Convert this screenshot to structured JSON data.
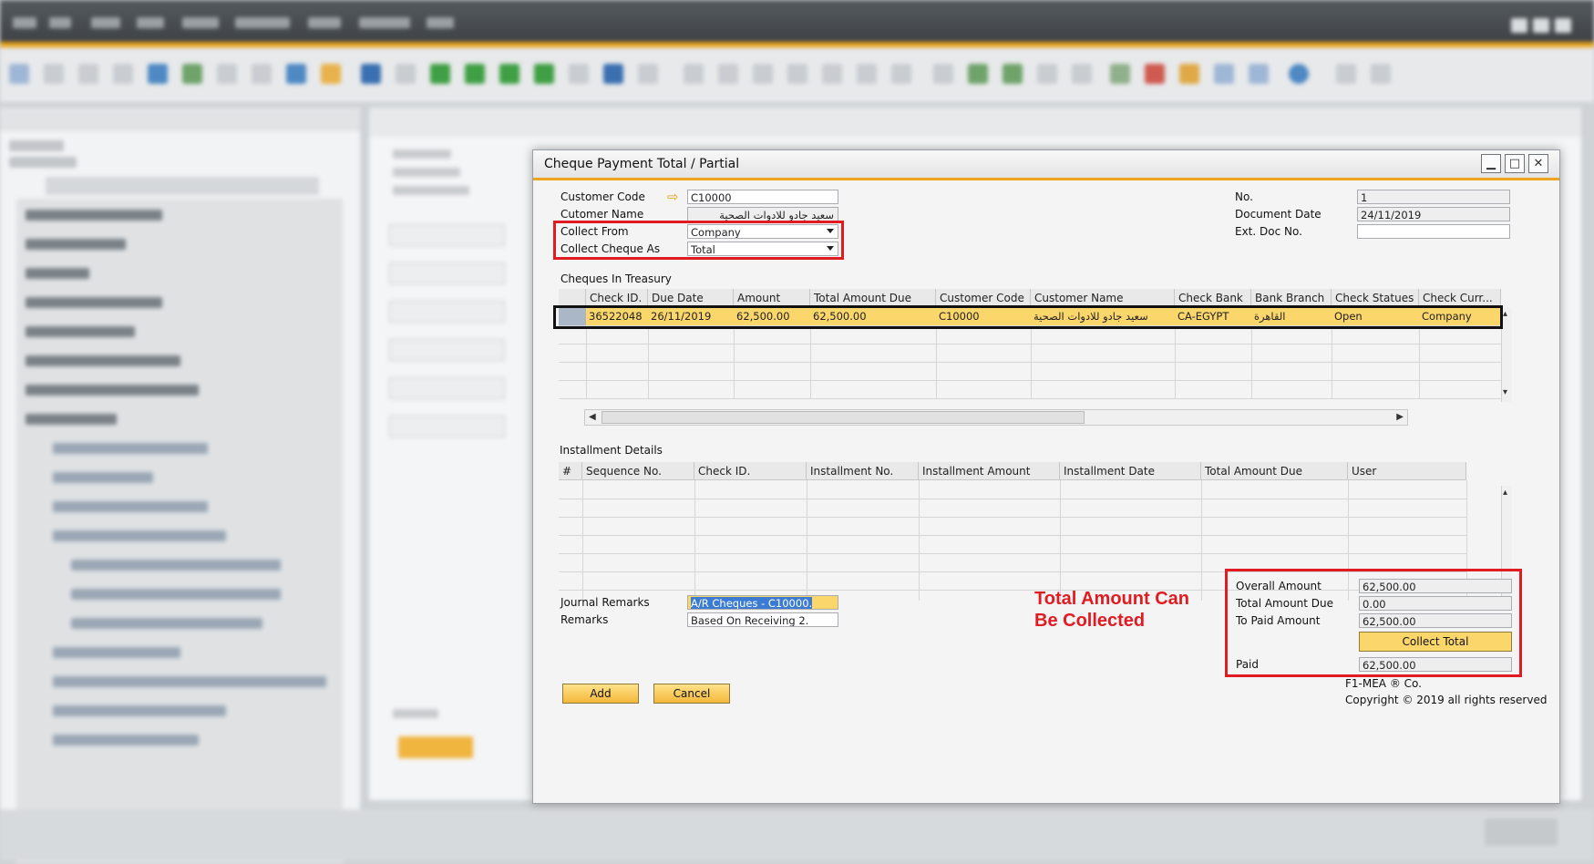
{
  "dialog": {
    "title": "Cheque Payment Total / Partial",
    "buttons": {
      "minimize": "▁",
      "maximize": "□",
      "close": "✕"
    }
  },
  "header": {
    "customer_code_label": "Customer Code",
    "customer_code": "C10000",
    "customer_name_label": "Cutomer Name",
    "customer_name": "سعيد جادو للادوات الصحية",
    "collect_from_label": "Collect From",
    "collect_from": "Company",
    "collect_as_label": "Collect Cheque As",
    "collect_as": "Total",
    "no_label": "No.",
    "no": "1",
    "doc_date_label": "Document Date",
    "doc_date": "24/11/2019",
    "ext_doc_label": "Ext. Doc No.",
    "ext_doc": ""
  },
  "treasury": {
    "title": "Cheques In Treasury",
    "columns": [
      "Check ID.",
      "Due Date",
      "Amount",
      "Total Amount Due",
      "Customer Code",
      "Customer Name",
      "Check Bank",
      "Bank Branch",
      "Check Statues",
      "Check Curr..."
    ],
    "rows": [
      [
        "36522048",
        "26/11/2019",
        "62,500.00",
        "62,500.00",
        "C10000",
        "سعيد جادو للادوات الصحية",
        "CA-EGYPT",
        "القاهرة",
        "Open",
        "Company"
      ]
    ]
  },
  "installments": {
    "title": "Installment Details",
    "columns": [
      "#",
      "Sequence No.",
      "Check ID.",
      "Installment No.",
      "Installment Amount",
      "Installment Date",
      "Total Amount Due",
      "User"
    ]
  },
  "remarks": {
    "journal_label": "Journal Remarks",
    "journal": "A/R Cheques - C10000.",
    "remarks_label": "Remarks",
    "remarks": "Based On Receiving 2."
  },
  "annotation": {
    "line1": "Total Amount Can",
    "line2": "Be Collected"
  },
  "totals": {
    "overall_label": "Overall Amount",
    "overall": "62,500.00",
    "due_label": "Total Amount Due",
    "due": "0.00",
    "to_paid_label": "To Paid Amount",
    "to_paid": "62,500.00",
    "collect_button": "Collect Total",
    "paid_label": "Paid",
    "paid": "62,500.00"
  },
  "footer": {
    "add": "Add",
    "cancel": "Cancel",
    "company": "F1-MEA ® Co.",
    "copyright": "Copyright © 2019 all rights reserved"
  },
  "colors": {
    "accent": "#efa420",
    "annotation_red": "#e01b22",
    "selected_row": "#fbd66b"
  }
}
